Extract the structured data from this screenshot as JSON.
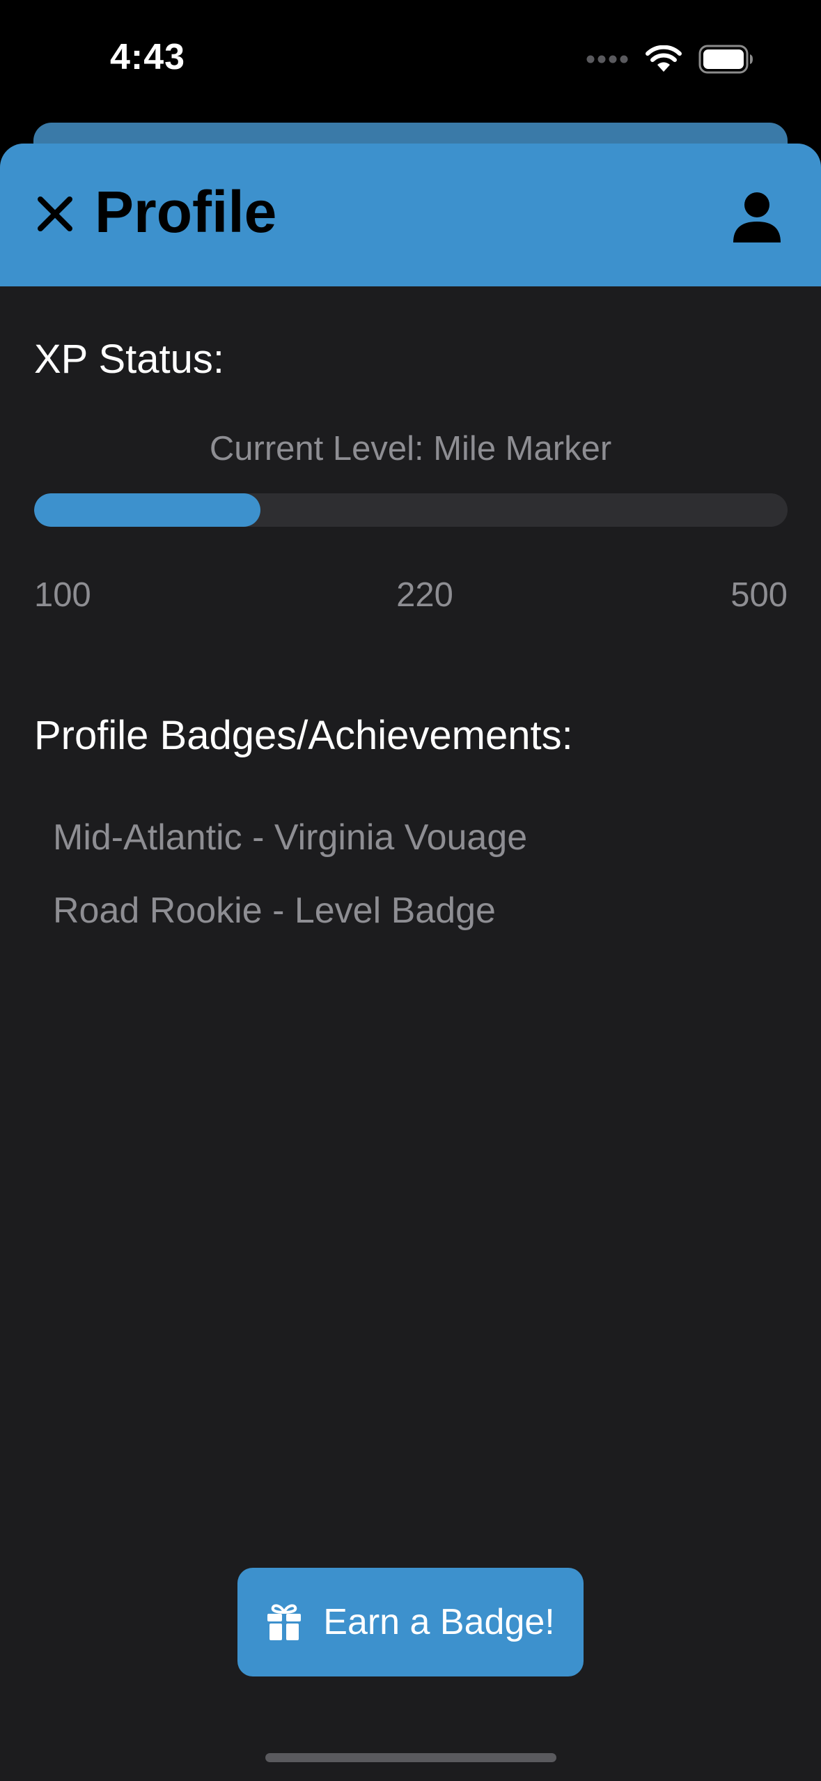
{
  "status_bar": {
    "time": "4:43",
    "icons": [
      "signal-dots-icon",
      "wifi-icon",
      "battery-icon"
    ]
  },
  "header": {
    "title": "Profile",
    "close_icon": "close-icon",
    "profile_icon": "person-icon"
  },
  "xp": {
    "section_label": "XP Status:",
    "current_level": "Current Level: Mile Marker",
    "min": "100",
    "current": "220",
    "max": "500",
    "progress_fraction": 0.3
  },
  "badges": {
    "section_label": "Profile Badges/Achievements:",
    "items": [
      "Mid-Atlantic - Virginia Vouage",
      "Road Rookie - Level Badge"
    ]
  },
  "earn_button": {
    "label": "Earn a Badge!",
    "icon": "gift-icon"
  },
  "colors": {
    "accent": "#3d91cd",
    "sheet_background": "#1c1c1e",
    "secondary_text": "#8e8e93"
  }
}
